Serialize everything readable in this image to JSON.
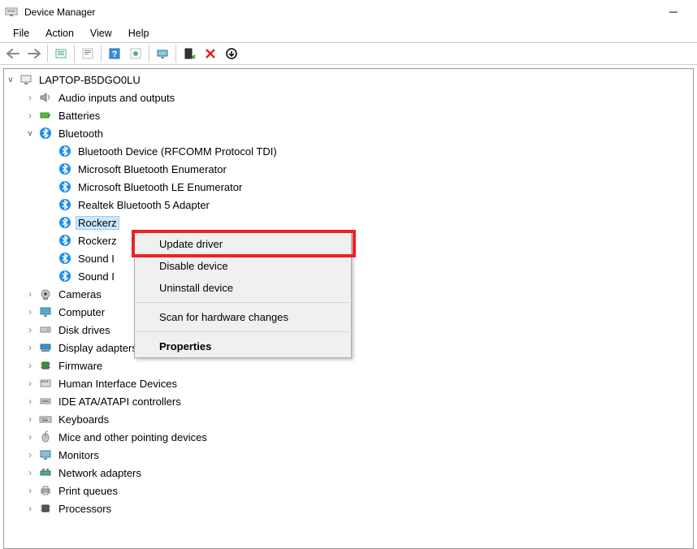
{
  "window": {
    "title": "Device Manager"
  },
  "menus": [
    "File",
    "Action",
    "View",
    "Help"
  ],
  "tree": {
    "root": {
      "label": "LAPTOP-B5DGO0LU"
    },
    "categories": [
      {
        "label": "Audio inputs and outputs",
        "expanded": false,
        "icon": "speaker"
      },
      {
        "label": "Batteries",
        "expanded": false,
        "icon": "battery"
      },
      {
        "label": "Bluetooth",
        "expanded": true,
        "icon": "bluetooth",
        "children": [
          {
            "label": "Bluetooth Device (RFCOMM Protocol TDI)"
          },
          {
            "label": "Microsoft Bluetooth Enumerator"
          },
          {
            "label": "Microsoft Bluetooth LE Enumerator"
          },
          {
            "label": "Realtek Bluetooth 5 Adapter"
          },
          {
            "label": "Rockerz",
            "selected": true
          },
          {
            "label": "Rockerz"
          },
          {
            "label": "Sound I"
          },
          {
            "label": "Sound I"
          }
        ]
      },
      {
        "label": "Cameras",
        "expanded": false,
        "icon": "camera"
      },
      {
        "label": "Computer",
        "expanded": false,
        "icon": "computer"
      },
      {
        "label": "Disk drives",
        "expanded": false,
        "icon": "disk"
      },
      {
        "label": "Display adapters",
        "expanded": false,
        "icon": "display"
      },
      {
        "label": "Firmware",
        "expanded": false,
        "icon": "chip"
      },
      {
        "label": "Human Interface Devices",
        "expanded": false,
        "icon": "hid"
      },
      {
        "label": "IDE ATA/ATAPI controllers",
        "expanded": false,
        "icon": "ide"
      },
      {
        "label": "Keyboards",
        "expanded": false,
        "icon": "keyboard"
      },
      {
        "label": "Mice and other pointing devices",
        "expanded": false,
        "icon": "mouse"
      },
      {
        "label": "Monitors",
        "expanded": false,
        "icon": "monitor"
      },
      {
        "label": "Network adapters",
        "expanded": false,
        "icon": "network"
      },
      {
        "label": "Print queues",
        "expanded": false,
        "icon": "printer"
      },
      {
        "label": "Processors",
        "expanded": false,
        "icon": "cpu"
      }
    ]
  },
  "context_menu": {
    "items": [
      {
        "label": "Update driver",
        "highlighted": true
      },
      {
        "label": "Disable device"
      },
      {
        "label": "Uninstall device"
      },
      {
        "sep": true
      },
      {
        "label": "Scan for hardware changes"
      },
      {
        "sep": true
      },
      {
        "label": "Properties",
        "bold": true
      }
    ]
  }
}
